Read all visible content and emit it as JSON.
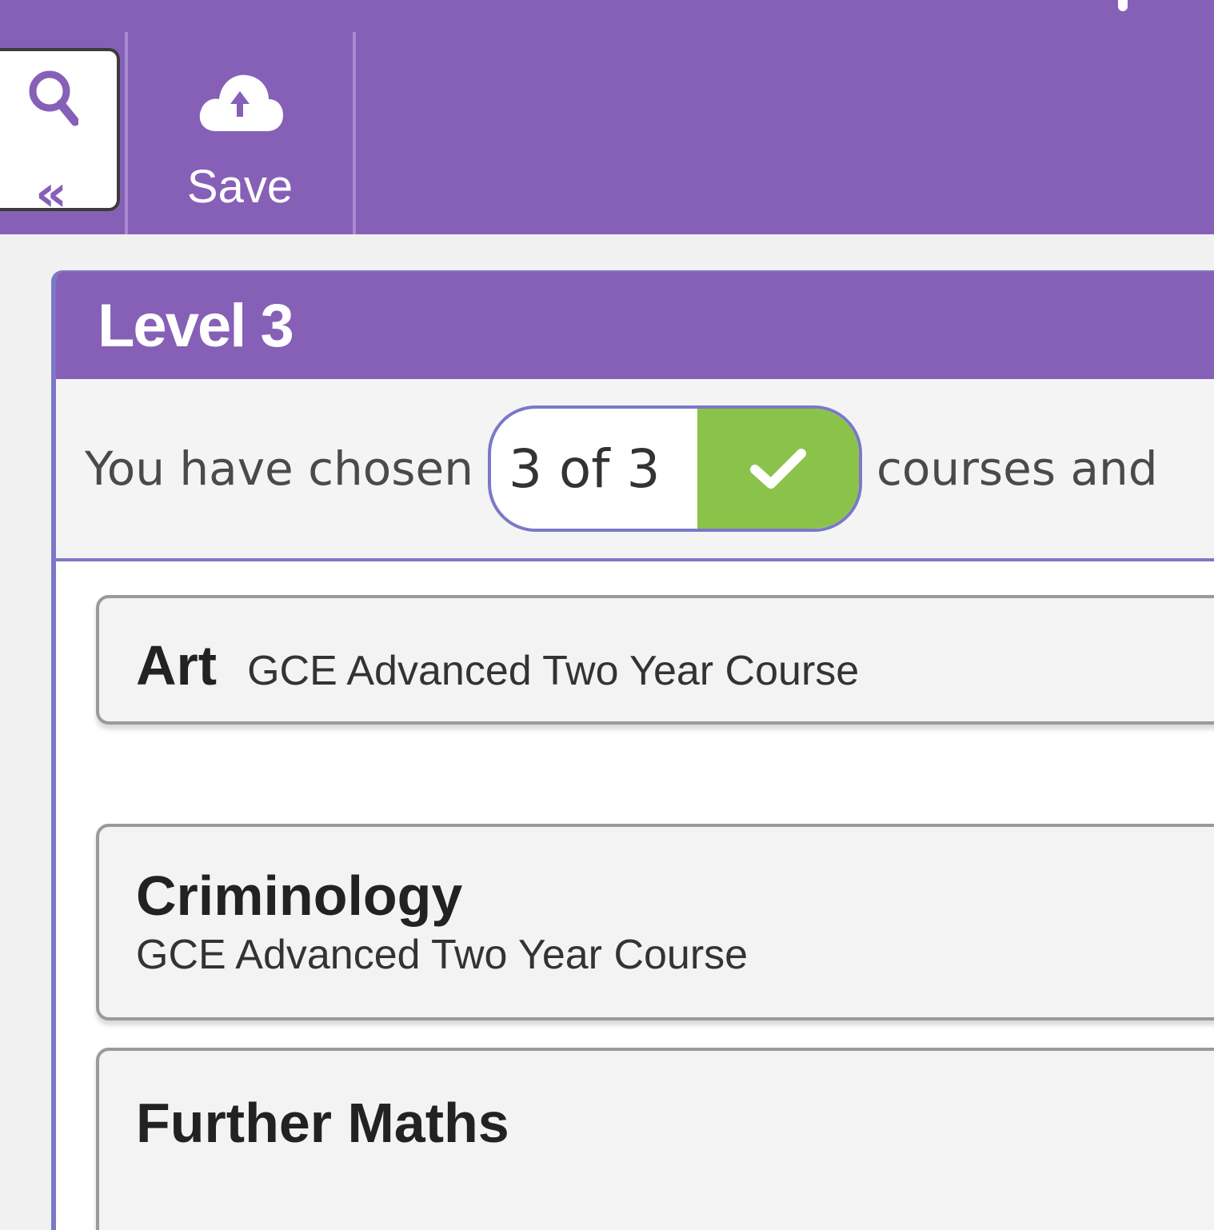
{
  "toolbar": {
    "save_label": "Save",
    "search_icon": "search-icon",
    "collapse_icon": "double-chevron-left-icon",
    "save_icon": "cloud-upload-icon"
  },
  "colors": {
    "brand_purple": "#8660b7",
    "border_blue": "#7b78c8",
    "success_green": "#8bc34a"
  },
  "panel": {
    "title": "Level 3",
    "summary": {
      "prefix": "You have chosen",
      "count": "3 of 3",
      "status_icon": "check-icon",
      "suffix": "courses and"
    }
  },
  "courses": [
    {
      "name": "Art",
      "qualification": "GCE Advanced Two Year Course"
    },
    {
      "name": "Criminology",
      "qualification": "GCE Advanced Two Year Course"
    },
    {
      "name": "Further Maths",
      "qualification": ""
    }
  ]
}
